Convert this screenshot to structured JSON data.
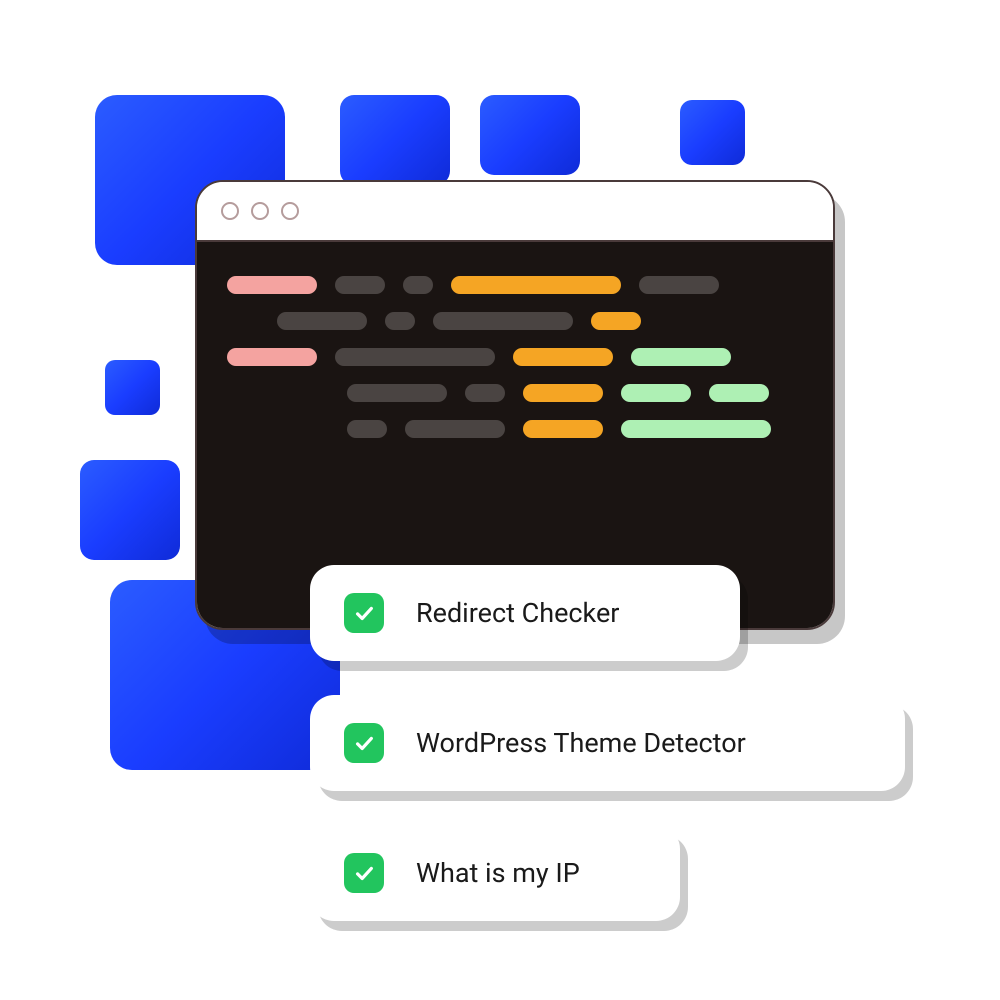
{
  "features": [
    {
      "label": "Redirect Checker"
    },
    {
      "label": "WordPress Theme Detector"
    },
    {
      "label": "What is my IP"
    }
  ]
}
